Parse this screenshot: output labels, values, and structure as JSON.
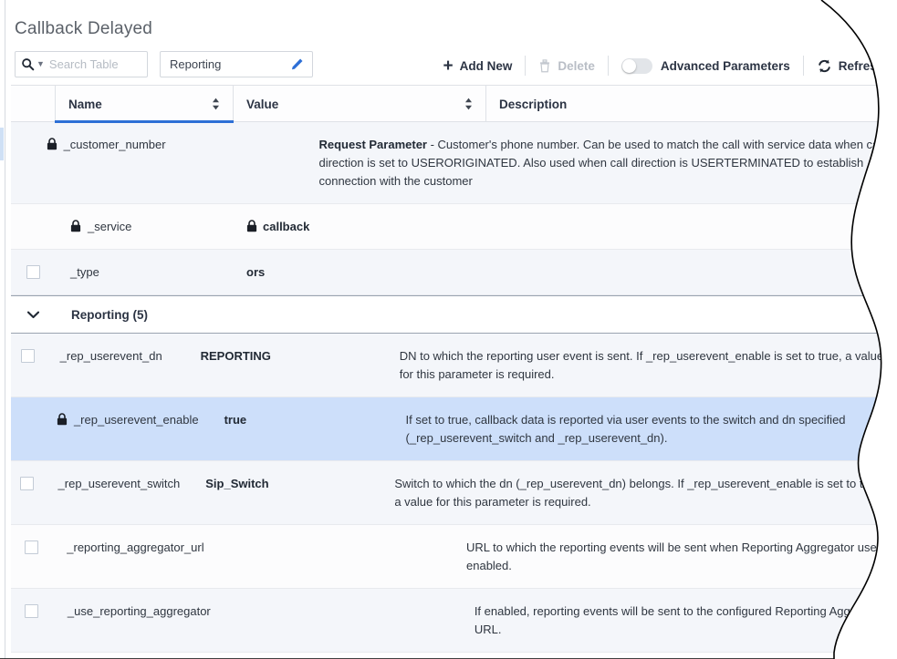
{
  "window": {
    "title": "Callback Delayed"
  },
  "toolbar": {
    "search": {
      "placeholder": "Search Table",
      "value": "",
      "icon": "search-icon",
      "caret_icon": "chevron-down-icon"
    },
    "filter": {
      "value": "Reporting",
      "edit_icon": "pencil-icon"
    },
    "add_new_label": "Add New",
    "delete_label": "Delete",
    "advanced_parameters_label": "Advanced Parameters",
    "advanced_parameters_on": false,
    "refresh_label": "Refresh"
  },
  "table": {
    "columns": [
      {
        "key": "name",
        "label": "Name",
        "sorted": true
      },
      {
        "key": "value",
        "label": "Value",
        "sorted": false
      },
      {
        "key": "description",
        "label": "Description",
        "sorted": false
      }
    ],
    "rows": [
      {
        "type": "data",
        "selectable": false,
        "locked_name": true,
        "locked_value": false,
        "name": "_customer_number",
        "value": "",
        "desc_strong": "Request Parameter",
        "desc": " - Customer's phone number. Can be used to match the call with service data when call direction is set to USERORIGINATED. Also used when call direction is USERTERMINATED to establish connection with the customer",
        "zebra": "alt",
        "selected": false
      },
      {
        "type": "data",
        "selectable": false,
        "locked_name": true,
        "locked_value": true,
        "name": "_service",
        "value": "callback",
        "desc_strong": "",
        "desc": "",
        "zebra": "",
        "selected": false
      },
      {
        "type": "data",
        "selectable": true,
        "locked_name": false,
        "locked_value": false,
        "name": "_type",
        "value": "ors",
        "desc_strong": "",
        "desc": "",
        "zebra": "alt",
        "selected": false
      },
      {
        "type": "group",
        "label": "Reporting (5)",
        "expanded": true,
        "chevron_icon": "chevron-down-icon"
      },
      {
        "type": "data",
        "selectable": true,
        "locked_name": false,
        "locked_value": false,
        "name": "_rep_userevent_dn",
        "value": "REPORTING",
        "desc_strong": "",
        "desc": "DN to which the reporting user event is sent. If _rep_userevent_enable is set to true, a value for this parameter is required.",
        "zebra": "alt",
        "selected": false
      },
      {
        "type": "data",
        "selectable": false,
        "locked_name": true,
        "locked_value": false,
        "name": "_rep_userevent_enable",
        "value": "true",
        "desc_strong": "",
        "desc": "If set to true, callback data is reported via user events to the switch and dn specified (_rep_userevent_switch and _rep_userevent_dn).",
        "zebra": "",
        "selected": true
      },
      {
        "type": "data",
        "selectable": true,
        "locked_name": false,
        "locked_value": false,
        "name": "_rep_userevent_switch",
        "value": "Sip_Switch",
        "desc_strong": "",
        "desc": "Switch to which the dn (_rep_userevent_dn) belongs. If _rep_userevent_enable is set to true, a value for this parameter is required.",
        "zebra": "alt",
        "selected": false
      },
      {
        "type": "data",
        "selectable": true,
        "locked_name": false,
        "locked_value": false,
        "name": "_reporting_aggregator_url",
        "value": "",
        "desc_strong": "",
        "desc": "URL to which the reporting events will be sent when Reporting Aggregator use enabled.",
        "zebra": "",
        "selected": false
      },
      {
        "type": "data",
        "selectable": true,
        "locked_name": false,
        "locked_value": false,
        "name": "_use_reporting_aggregator",
        "value": "",
        "desc_strong": "",
        "desc": "If enabled, reporting events will be sent to the configured Reporting Aggregator URL.",
        "zebra": "alt",
        "selected": false
      }
    ]
  },
  "colors": {
    "accent": "#2d6fd6",
    "selected_row": "#cddffa",
    "zebra_row": "#f4f6fa",
    "text": "#2f3640",
    "muted": "#b6bcc4"
  }
}
